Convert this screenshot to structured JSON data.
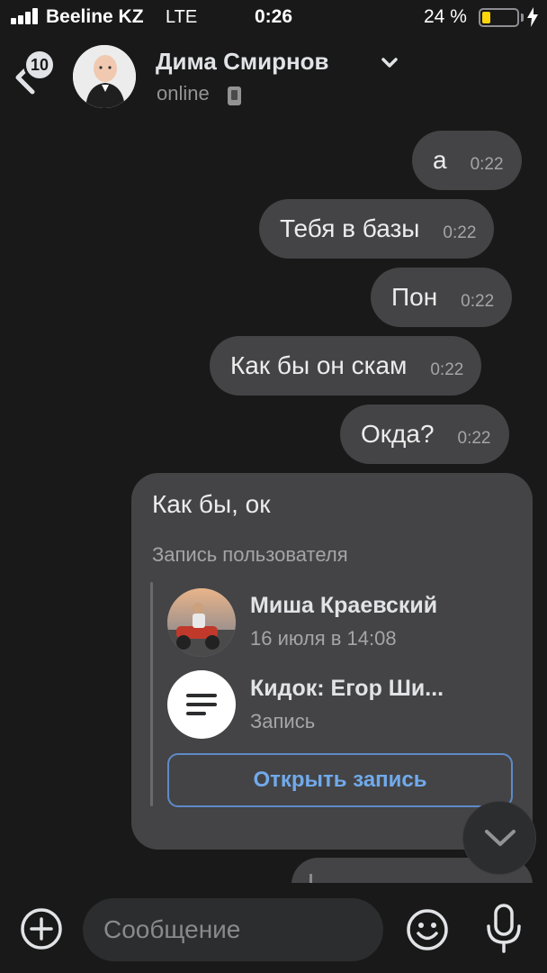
{
  "status_bar": {
    "carrier": "Beeline KZ",
    "network": "LTE",
    "time": "0:26",
    "battery_percent": "24 %",
    "battery_level": 0.24
  },
  "header": {
    "back_badge": "10",
    "contact_name": "Дима Смирнов",
    "contact_status": "online"
  },
  "messages": [
    {
      "text": "а",
      "time": "0:22"
    },
    {
      "text": "Тебя в базы",
      "time": "0:22"
    },
    {
      "text": "Пон",
      "time": "0:22"
    },
    {
      "text": "Как бы он скам",
      "time": "0:22"
    },
    {
      "text": "Окда?",
      "time": "0:22"
    }
  ],
  "repost_message": {
    "text": "Как бы, ок",
    "label": "Запись пользователя",
    "author": "Миша Краевский",
    "date": "16 июля в 14:08",
    "title": "Кидок: Егор Ши...",
    "type": "Запись",
    "open_button": "Открыть запись"
  },
  "composer": {
    "placeholder": "Сообщение"
  },
  "colors": {
    "background": "#191919",
    "bubble": "#444446",
    "accent": "#71aaeb",
    "battery": "#ffd60a"
  }
}
